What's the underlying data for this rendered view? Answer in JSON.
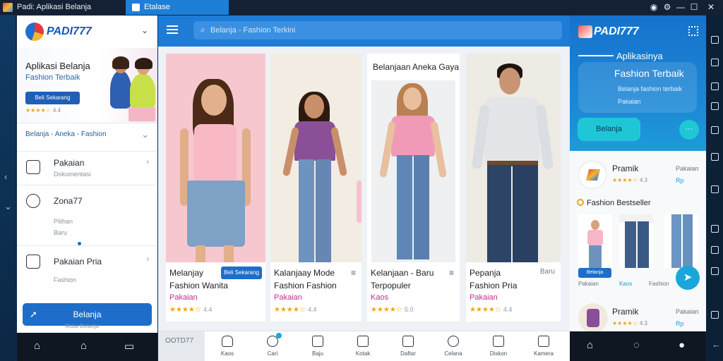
{
  "titlebar": {
    "title": "Padi: Aplikasi Belanja",
    "tab_label": "Etalase",
    "controls": [
      "◉",
      "⚙",
      "—",
      "☐",
      "✕"
    ]
  },
  "left_panel": {
    "brand": "PADI777",
    "promo": {
      "title": "Aplikasi Belanja",
      "subtitle": "Fashion Terbaik",
      "button": "Beli Sekarang",
      "rating": "★★★★☆",
      "rating_count": "4.4"
    },
    "category_selector": "Belanja - Aneka - Fashion",
    "menu": [
      {
        "title": "Pakaian",
        "subtitle": "Dokumentasi"
      },
      {
        "title": "Zona77",
        "subtitle": "Pilihan",
        "subtitle2": "Baru"
      },
      {
        "title": "Pakaian Pria",
        "subtitle": "Fashion"
      }
    ],
    "cta_button": "Belanja",
    "cta_caption": "Mulai Belanja"
  },
  "center": {
    "search_placeholder": "Belanja - Fashion Terkini",
    "cards": [
      {
        "line1": "Melanjay",
        "line2": "Fashion Wanita",
        "line3": "Pakaian",
        "rating": "★★★★☆",
        "rating_count": "4.4",
        "button": "Beli Sekarang"
      },
      {
        "line1": "Kalanjaay Mode",
        "line2": "Fashion Fashion",
        "line3": "Pakaian",
        "rating": "★★★★☆",
        "rating_count": "4.4"
      },
      {
        "overlay_title": "Belanjaan Aneka Gaya",
        "line1": "Kelanjaan - Baru",
        "line2": "Terpopuler",
        "line3": "Kaos",
        "rating": "★★★★☆",
        "rating_count": "5.0"
      },
      {
        "line1": "Pepanja",
        "line2": "Fashion Pria",
        "line3": "Pakaian",
        "rating": "★★★★☆",
        "rating_count": "4.4",
        "side": "Baru"
      }
    ],
    "bottom_tabs": [
      {
        "label": "Kaos"
      },
      {
        "label": "Cari"
      },
      {
        "label": "Baju"
      },
      {
        "label": "Kotak"
      },
      {
        "label": "Daftar"
      },
      {
        "label": "Celana"
      },
      {
        "label": "Diskon"
      },
      {
        "label": "Kamera"
      }
    ],
    "bottom_first": "OOTD77"
  },
  "right_panel": {
    "brand": "PADI777",
    "hero_line1": "Aplikasinya",
    "hero_line2": "Fashion Terbaik",
    "hero_line3": "Belanja fashion terbaik",
    "hero_line4": "Pakaian",
    "hero_button": "Belanja",
    "hero_round": "···",
    "item1": {
      "name": "Pramik",
      "side": "Pakaian",
      "rating": "★★★★☆",
      "rating_count": "4.3",
      "price": "Rp"
    },
    "section_title": "Fashion Bestseller",
    "thumb_button": "Belanja",
    "thumb_labels": [
      "Pakaian",
      "Kaos",
      "Fashion"
    ],
    "item2": {
      "name": "Pramik",
      "side": "Pakaian",
      "rating": "★★★★☆",
      "rating_count": "4.3",
      "price": "Rp"
    }
  }
}
